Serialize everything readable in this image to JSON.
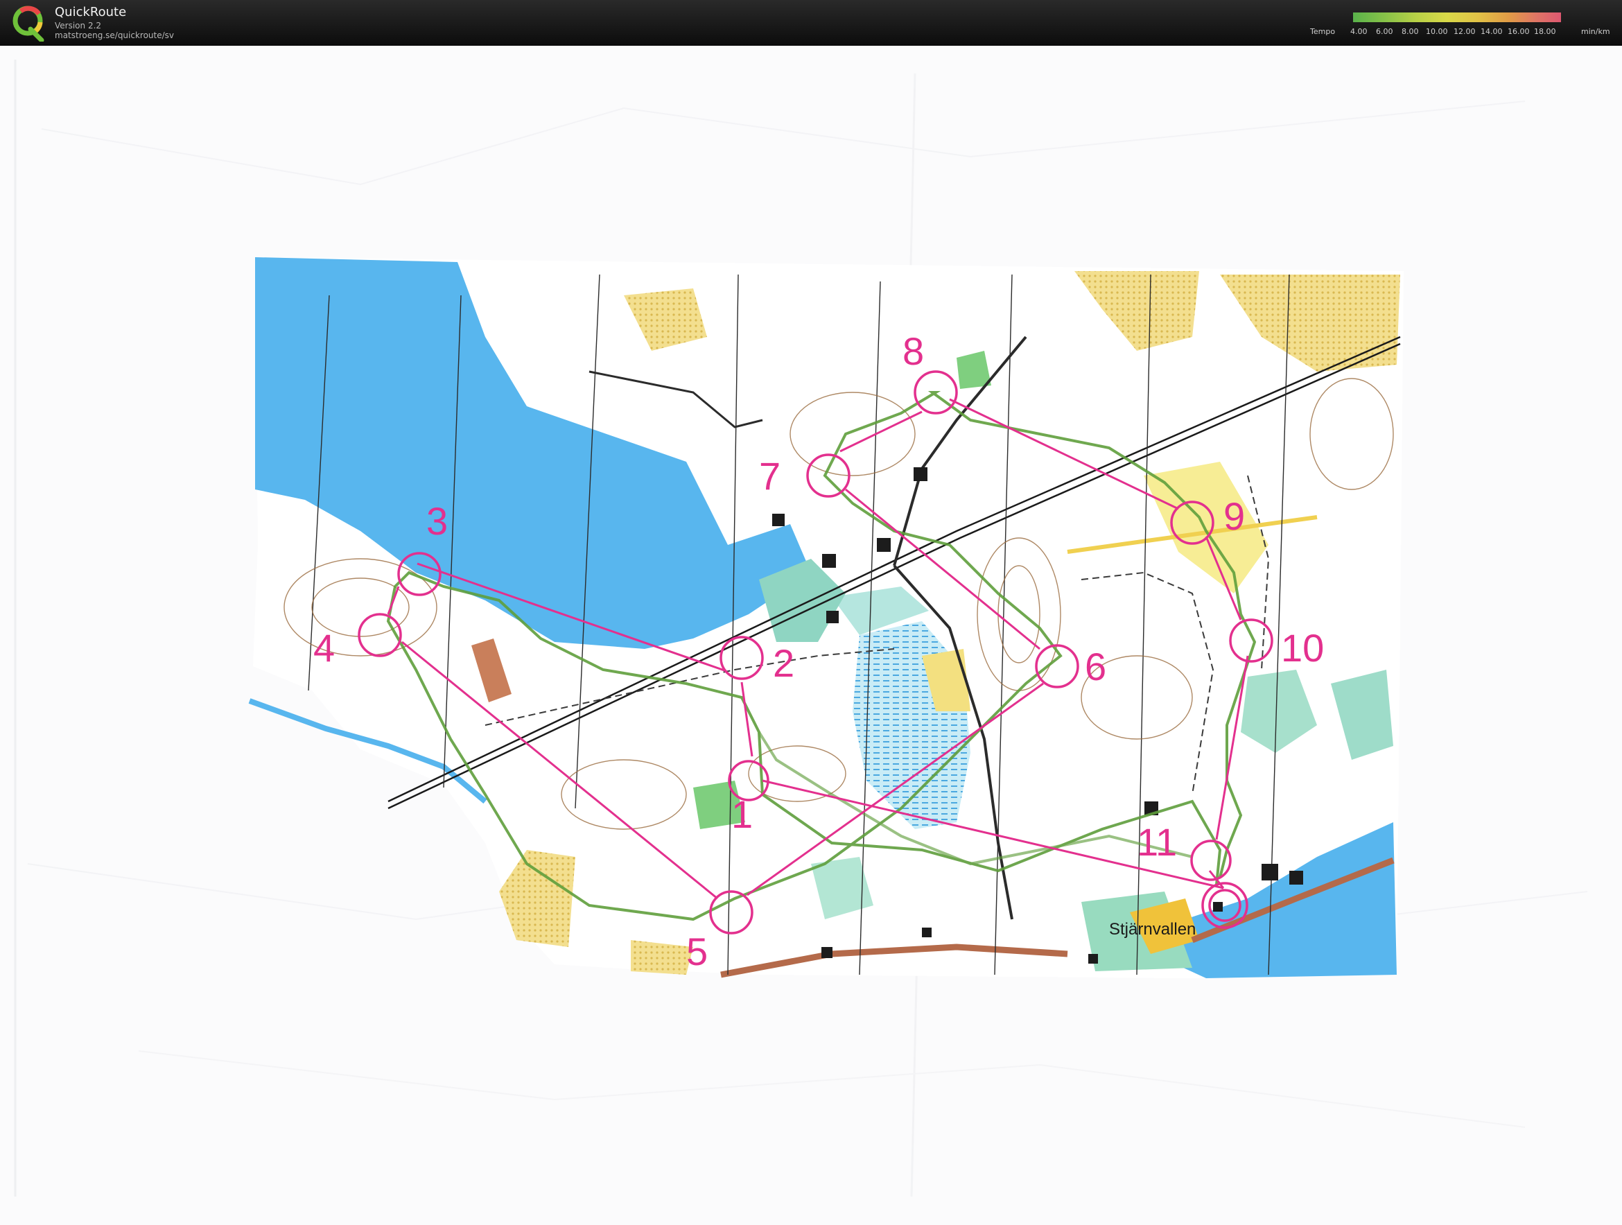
{
  "app": {
    "title": "QuickRoute",
    "version": "Version 2.2",
    "url": "matstroeng.se/quickroute/sv"
  },
  "tempo_legend": {
    "label": "Tempo",
    "ticks": [
      "4.00",
      "6.00",
      "8.00",
      "10.00",
      "12.00",
      "14.00",
      "16.00",
      "18.00"
    ],
    "unit": "min/km"
  },
  "map": {
    "course_color": "#e3308e",
    "route_color": "#5f9e3c",
    "water_color": "#58b6ee",
    "place_label": "Stjärnvallen",
    "controls": [
      {
        "number": "1"
      },
      {
        "number": "2"
      },
      {
        "number": "3"
      },
      {
        "number": "4"
      },
      {
        "number": "5"
      },
      {
        "number": "6"
      },
      {
        "number": "7"
      },
      {
        "number": "8"
      },
      {
        "number": "9"
      },
      {
        "number": "10"
      },
      {
        "number": "11"
      }
    ]
  }
}
